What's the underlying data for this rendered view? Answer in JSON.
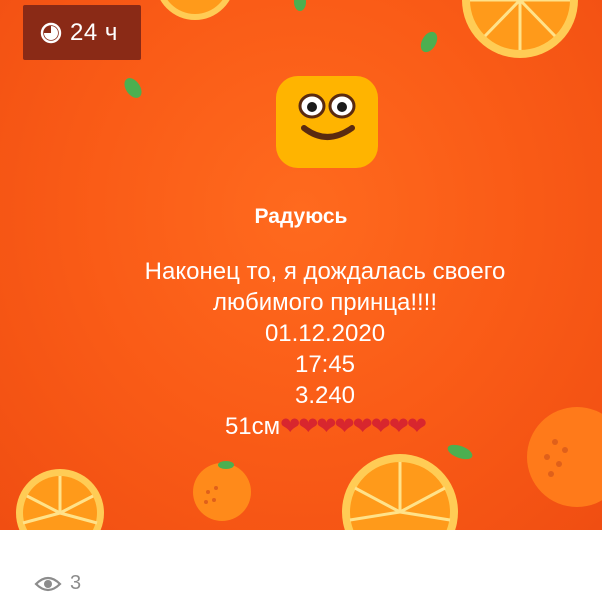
{
  "badge": {
    "icon": "timer-icon",
    "label": "24 ч"
  },
  "mood": {
    "icon": "smiley-face-icon",
    "title": "Радуюсь"
  },
  "message": {
    "lines": [
      "Наконец то, я дождалась своего",
      "любимого принца!!!!",
      "01.12.2020",
      "17:45",
      "3.240"
    ],
    "last_text": "51см",
    "hearts": "❤❤❤❤❤❤❤❤"
  },
  "footer": {
    "icon": "eye-icon",
    "views": "3"
  },
  "colors": {
    "background": "#f95a16",
    "badge": "#8a2a16",
    "face": "#ffb400",
    "hearts": "#d8262e"
  }
}
